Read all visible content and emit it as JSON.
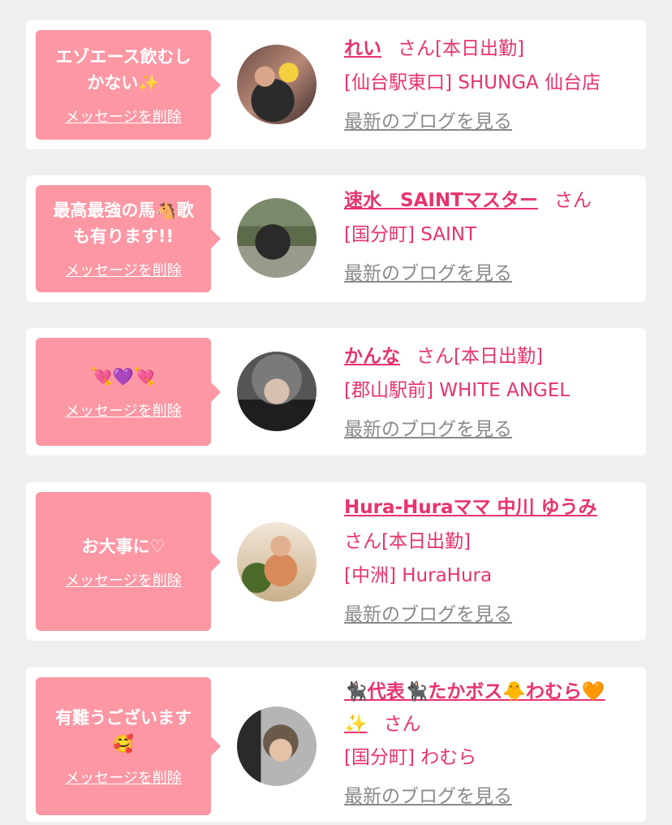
{
  "colors": {
    "accent": "#e8336c",
    "bubble": "#fd97a4",
    "link_gray": "#8a8a8a",
    "background": "#efefef"
  },
  "delete_label": "メッセージを削除",
  "blog_label": "最新のブログを見る",
  "san": "さん",
  "cards": [
    {
      "message": "エゾエース飲むし\nかない✨",
      "name": "れい",
      "status": "[本日出勤]",
      "shop": "[仙台駅東口] SHUNGA 仙台店"
    },
    {
      "message": "最高最強の馬🐴歌\nも有ります!!",
      "name": "速水　SAINTマスター",
      "status": "",
      "shop": "[国分町] SAINT"
    },
    {
      "message": "💘💜💘",
      "name": "かんな",
      "status": "[本日出勤]",
      "shop": "[郡山駅前] WHITE ANGEL"
    },
    {
      "message": "お大事に♡",
      "name": "Hura-Huraママ 中川 ゆうみ",
      "status": "[本日出勤]",
      "shop": "[中洲] HuraHura"
    },
    {
      "message": "有難うございます\n🥰",
      "name": "🐈‍⬛代表🐈‍⬛たかボス🐥わむら🧡✨",
      "status": "",
      "shop": "[国分町] わむら"
    }
  ]
}
